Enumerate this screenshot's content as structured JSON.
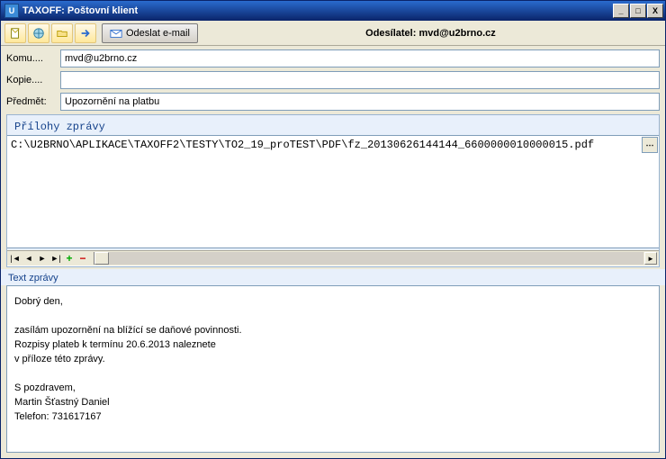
{
  "window": {
    "icon_letter": "U",
    "title": "TAXOFF: Poštovní klient"
  },
  "toolbar": {
    "send_label": "Odeslat e-mail",
    "sender_label": "Odesílatel: mvd@u2brno.cz"
  },
  "fields": {
    "to_label": "Komu....",
    "to_value": "mvd@u2brno.cz",
    "cc_label": "Kopie....",
    "cc_value": "",
    "subject_label": "Předmět:",
    "subject_value": "Upozornění na platbu"
  },
  "attachments": {
    "section_label": "Přílohy zprávy",
    "rows": [
      "C:\\U2BRNO\\APLIKACE\\TAXOFF2\\TESTY\\TO2_19_proTEST\\PDF\\fz_20130626144144_6600000010000015.pdf"
    ],
    "more_button": "⋯"
  },
  "message": {
    "section_label": "Text zprávy",
    "body": "Dobrý den,\n\nzasílám upozornění na blížící se daňové povinnosti.\nRozpisy plateb k termínu 20.6.2013 naleznete\nv příloze této zprávy.\n\nS pozdravem,\n Martin Šťastný Daniel\n Telefon:  731617167"
  },
  "win_buttons": {
    "min": "_",
    "max": "□",
    "close": "X"
  }
}
